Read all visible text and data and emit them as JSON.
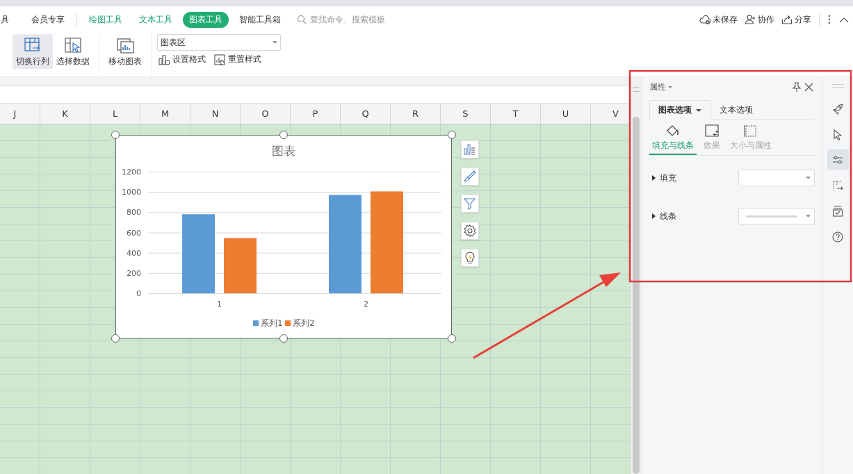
{
  "ribbon": {
    "tabs": [
      {
        "label": "具",
        "kind": "plain",
        "selected": false
      },
      {
        "label": "会员专享",
        "kind": "plain",
        "selected": false
      },
      {
        "label": "绘图工具",
        "kind": "context",
        "selected": false
      },
      {
        "label": "文本工具",
        "kind": "context",
        "selected": false
      },
      {
        "label": "图表工具",
        "kind": "context",
        "selected": true
      },
      {
        "label": "智能工具箱",
        "kind": "plain",
        "selected": false
      }
    ],
    "search": {
      "placeholder": "查找命令、搜索模板"
    },
    "actions": [
      {
        "label": "未保存",
        "kind": "cloud"
      },
      {
        "label": "协作",
        "kind": "user"
      },
      {
        "label": "分享",
        "kind": "share"
      }
    ],
    "tools": [
      {
        "label": "切换行列",
        "kind": "switch",
        "selected": true
      },
      {
        "label": "选择数据",
        "kind": "select",
        "selected": false
      },
      {
        "label": "移动图表",
        "kind": "move",
        "selected": false
      }
    ],
    "element_select": {
      "value": "图表区"
    },
    "small_tools": [
      {
        "label": "设置格式",
        "kind": "format"
      },
      {
        "label": "重置样式",
        "kind": "reset"
      }
    ]
  },
  "sheet": {
    "columns": [
      "J",
      "K",
      "L",
      "M",
      "N",
      "O",
      "P",
      "Q",
      "R",
      "S",
      "T",
      "U",
      "V"
    ]
  },
  "chart": {
    "chart_data": {
      "type": "bar",
      "title": "图表",
      "categories": [
        "1",
        "2"
      ],
      "series": [
        {
          "name": "系列1",
          "color": "#5b9bd5",
          "values": [
            780,
            970
          ]
        },
        {
          "name": "系列2",
          "color": "#ed7d31",
          "values": [
            545,
            1005
          ]
        }
      ],
      "ylim": [
        0,
        1200
      ],
      "yticks": [
        0,
        200,
        400,
        600,
        800,
        1000,
        1200
      ],
      "grid": true,
      "legend": true
    }
  },
  "panel": {
    "title": "属性",
    "tabs": [
      {
        "label": "图表选项",
        "selected": true
      },
      {
        "label": "文本选项",
        "selected": false
      }
    ],
    "subtabs": [
      {
        "label": "填充与线条",
        "kind": "fill",
        "selected": true
      },
      {
        "label": "效果",
        "kind": "effect",
        "selected": false
      },
      {
        "label": "大小与属性",
        "kind": "size",
        "selected": false
      }
    ],
    "sections": [
      {
        "label": "填充",
        "kind": "fill"
      },
      {
        "label": "线条",
        "kind": "line"
      }
    ]
  },
  "side_icons": [
    {
      "kind": "rocket",
      "selected": false
    },
    {
      "kind": "pointer",
      "selected": false
    },
    {
      "kind": "sliders",
      "selected": true
    },
    {
      "kind": "swap",
      "selected": false
    },
    {
      "kind": "tray",
      "selected": false
    },
    {
      "kind": "help",
      "selected": false
    }
  ]
}
